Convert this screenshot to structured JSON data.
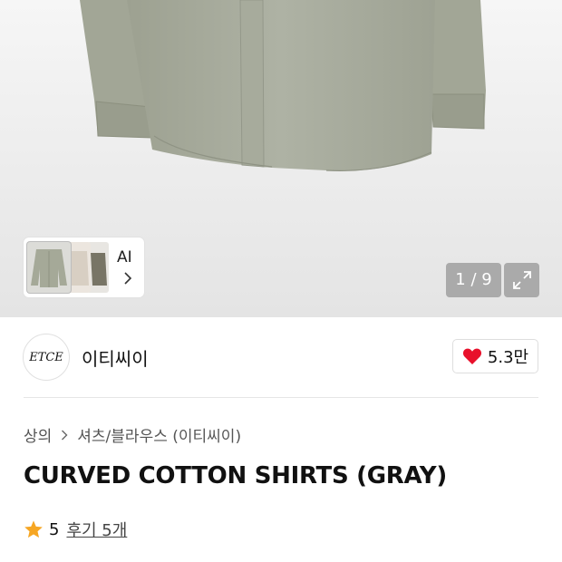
{
  "gallery": {
    "current_page": "1",
    "total_pages": "9",
    "counter_text": "1 / 9",
    "ai_label": "AI",
    "product_color": "#a7ab9d"
  },
  "brand": {
    "logo_text": "ETCE",
    "name": "이티씨이"
  },
  "like": {
    "count": "5.3만",
    "heart_color": "#e8102b"
  },
  "breadcrumb": {
    "items": [
      "상의",
      "셔츠/블라우스 (이티씨이)"
    ]
  },
  "product": {
    "title": "CURVED COTTON SHIRTS (GRAY)"
  },
  "rating": {
    "score": "5",
    "review_link": "후기 5개",
    "star_color": "#f6a623"
  }
}
